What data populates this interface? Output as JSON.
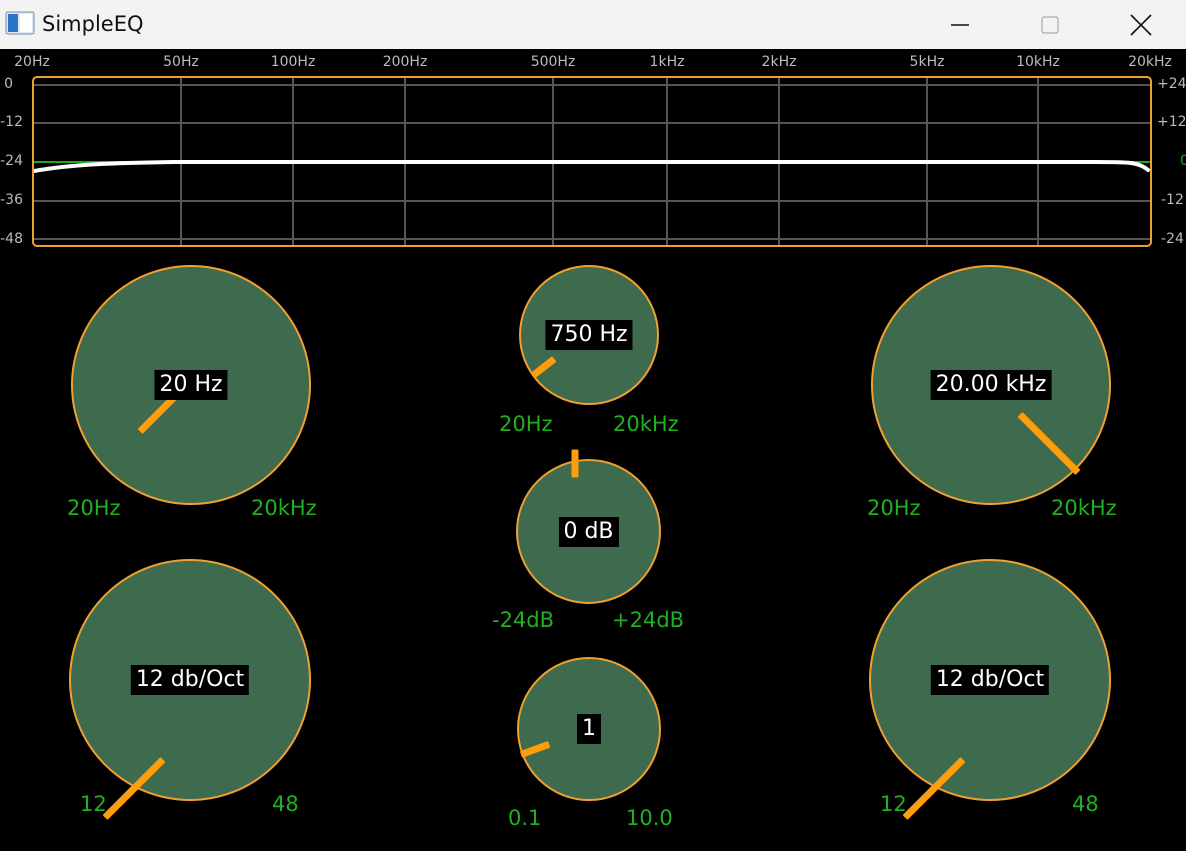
{
  "window": {
    "title": "SimpleEQ",
    "app_icon": "app-window-icon"
  },
  "window_controls": {
    "minimize_icon": "minimize-icon",
    "maximize_icon": "maximize-icon",
    "close_icon": "close-icon"
  },
  "analyzer": {
    "freq_labels": [
      "20Hz",
      "50Hz",
      "100Hz",
      "200Hz",
      "500Hz",
      "1kHz",
      "2kHz",
      "5kHz",
      "10kHz",
      "20kHz"
    ],
    "spectrum_db_labels": [
      "0",
      "-12",
      "-24",
      "-36",
      "-48"
    ],
    "gain_db_labels": [
      "+24",
      "+12",
      "0",
      "-12",
      "-24"
    ],
    "colors": {
      "border": "#f0a030",
      "grid": "#555555",
      "response": "#ffffff",
      "zero_line": "#1fa81f"
    }
  },
  "knobs": {
    "low_cut_freq": {
      "value": "20 Hz",
      "min": "20Hz",
      "max": "20kHz"
    },
    "peak_freq": {
      "value": "750 Hz",
      "min": "20Hz",
      "max": "20kHz"
    },
    "high_cut_freq": {
      "value": "20.00 kHz",
      "min": "20Hz",
      "max": "20kHz"
    },
    "peak_gain": {
      "value": "0 dB",
      "min": "-24dB",
      "max": "+24dB"
    },
    "low_cut_slope": {
      "value": "12 db/Oct",
      "min": "12",
      "max": "48"
    },
    "peak_quality": {
      "value": "1",
      "min": "0.1",
      "max": "10.0"
    },
    "high_cut_slope": {
      "value": "12 db/Oct",
      "min": "12",
      "max": "48"
    }
  },
  "colors": {
    "knob_fill": "#3e6b4e",
    "knob_border": "#f0a030",
    "pointer": "#ff9d0a",
    "range_text": "#20b020"
  }
}
